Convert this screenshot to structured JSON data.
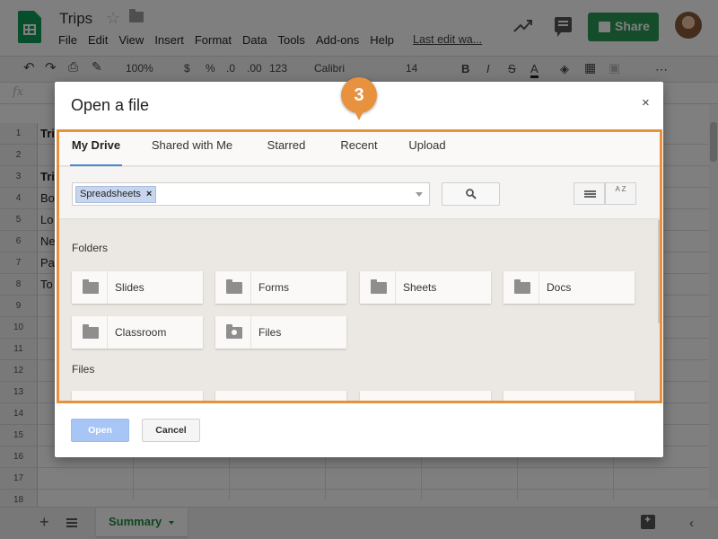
{
  "header": {
    "doc_title": "Trips",
    "menu": [
      "File",
      "Edit",
      "View",
      "Insert",
      "Format",
      "Data",
      "Tools",
      "Add-ons",
      "Help"
    ],
    "last_edit": "Last edit wa...",
    "share_label": "Share"
  },
  "toolbar": {
    "zoom": "100%",
    "currency": "$",
    "percent": "%",
    "dec_less": ".0",
    "dec_more": ".00",
    "format_more": "123",
    "font": "Calibri",
    "font_size": "14",
    "bold": "B",
    "italic": "I",
    "strike": "S",
    "text_color": "A",
    "more": "⋯"
  },
  "formula_bar": {
    "fx": "fx"
  },
  "sheet": {
    "rows": [
      "1",
      "2",
      "3",
      "4",
      "5",
      "6",
      "7",
      "8",
      "9",
      "10",
      "11",
      "12",
      "13",
      "14",
      "15",
      "16",
      "17",
      "18"
    ],
    "cells": [
      {
        "row": "1",
        "text": "Tri",
        "bold": true
      },
      {
        "row": "3",
        "text": "Tri",
        "bold": true
      },
      {
        "row": "4",
        "text": "Bo",
        "bold": false
      },
      {
        "row": "5",
        "text": "Lo",
        "bold": false
      },
      {
        "row": "6",
        "text": "Ne",
        "bold": false
      },
      {
        "row": "7",
        "text": "Pa",
        "bold": false
      },
      {
        "row": "8",
        "text": "To",
        "bold": false
      }
    ]
  },
  "bottom_bar": {
    "add": "+",
    "sheet_tab": "Summary"
  },
  "dialog": {
    "title": "Open a file",
    "close": "×",
    "tabs": [
      "My Drive",
      "Shared with Me",
      "Starred",
      "Recent",
      "Upload"
    ],
    "active_tab": "My Drive",
    "filter_chip": "Spreadsheets",
    "chip_remove": "×",
    "sort_label": "A Z",
    "folders_label": "Folders",
    "folders": [
      {
        "name": "Slides",
        "icon": "folder-icon"
      },
      {
        "name": "Forms",
        "icon": "folder-icon"
      },
      {
        "name": "Sheets",
        "icon": "folder-icon"
      },
      {
        "name": "Docs",
        "icon": "folder-icon"
      },
      {
        "name": "Classroom",
        "icon": "folder-icon"
      },
      {
        "name": "Files",
        "icon": "shared-folder-icon"
      }
    ],
    "files_label": "Files",
    "open_label": "Open",
    "cancel_label": "Cancel"
  },
  "step_marker": "3",
  "colors": {
    "accent_orange": "#e8913f",
    "share_green": "#2b9a57",
    "open_blue": "#a7c6f6",
    "active_tab_underline": "#4a86d6"
  }
}
